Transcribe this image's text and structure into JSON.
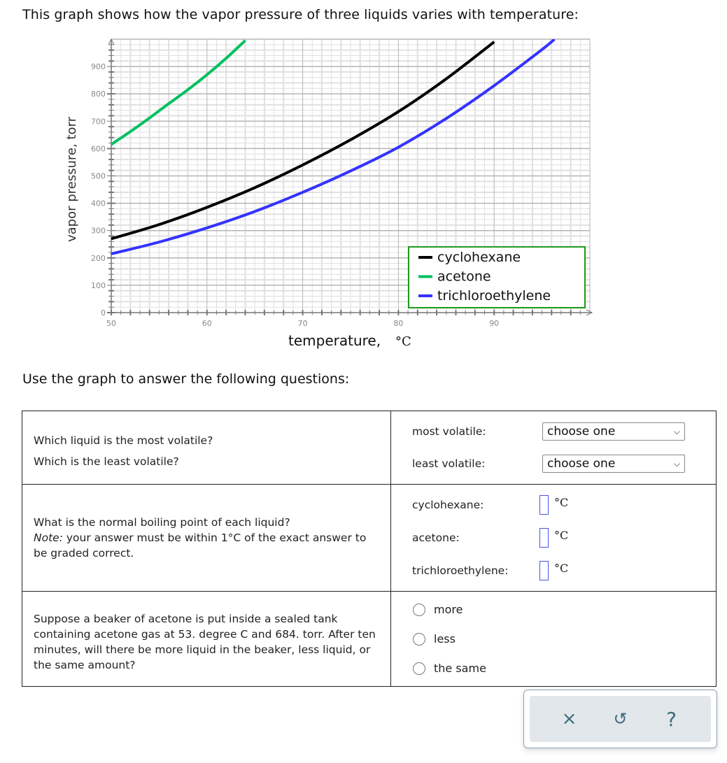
{
  "intro": "This graph shows how the vapor pressure of three liquids varies with temperature:",
  "chart_data": {
    "type": "line",
    "title": "",
    "xlabel": "temperature,",
    "xunit": "°C",
    "ylabel": "vapor pressure, torr",
    "xlim": [
      50,
      100
    ],
    "ylim": [
      0,
      1000
    ],
    "x_ticks": [
      50,
      60,
      70,
      80,
      90
    ],
    "y_ticks": [
      0,
      100,
      200,
      300,
      400,
      500,
      600,
      700,
      800,
      900
    ],
    "grid": true,
    "legend_position": "bottom-right",
    "series": [
      {
        "name": "cyclohexane",
        "color": "#000000",
        "x": [
          50,
          55,
          60,
          65,
          70,
          75,
          80,
          85,
          90
        ],
        "y": [
          270,
          322,
          385,
          457,
          540,
          632,
          735,
          855,
          990
        ]
      },
      {
        "name": "acetone",
        "color": "#00c060",
        "x": [
          50,
          52,
          54,
          56,
          58,
          60,
          62,
          64
        ],
        "y": [
          615,
          662,
          712,
          764,
          815,
          870,
          930,
          995
        ]
      },
      {
        "name": "trichloroethylene",
        "color": "#3333ff",
        "x": [
          50,
          55,
          60,
          65,
          70,
          75,
          80,
          85,
          90,
          95,
          96.3
        ],
        "y": [
          215,
          258,
          310,
          370,
          440,
          518,
          605,
          710,
          830,
          962,
          1000
        ]
      }
    ]
  },
  "subhead": "Use the graph to answer the following questions:",
  "questions": {
    "q1": {
      "line1": "Which liquid is the most volatile?",
      "line2": "Which is the least volatile?",
      "most_label": "most volatile:",
      "least_label": "least volatile:",
      "most_value": "choose one",
      "least_value": "choose one"
    },
    "q2": {
      "line1": "What is the normal boiling point of each liquid?",
      "note_label": "Note:",
      "note_text": " your answer must be within 1°C of the exact answer to be graded correct.",
      "items": [
        {
          "label": "cyclohexane:",
          "value": "",
          "unit": "°C"
        },
        {
          "label": "acetone:",
          "value": "",
          "unit": "°C"
        },
        {
          "label": "trichloroethylene:",
          "value": "",
          "unit": "°C"
        }
      ]
    },
    "q3": {
      "text": "Suppose a beaker of acetone is put inside a sealed tank containing acetone gas at 53. degree C and 684. torr. After ten minutes, will there be more liquid in the beaker, less liquid, or the same amount?",
      "options": [
        "more",
        "less",
        "the same"
      ]
    }
  },
  "toolbar": {
    "clear_icon": "×",
    "undo_icon": "↺",
    "help_icon": "?"
  }
}
